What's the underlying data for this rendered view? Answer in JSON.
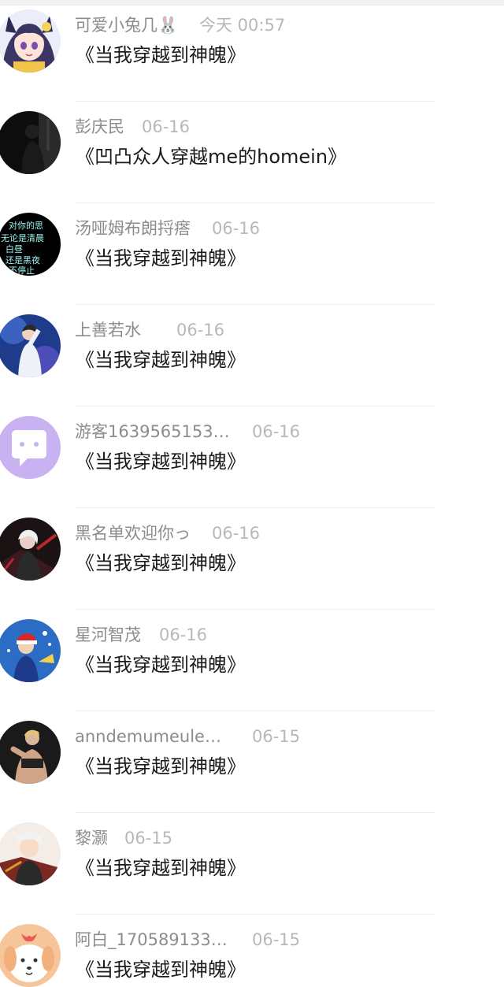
{
  "comments": [
    {
      "user": "可爱小兔几🐰",
      "date": "今天 00:57",
      "text": "《当我穿越到神魄》",
      "avatar": "anime-girl-avatar"
    },
    {
      "user": "彭庆民",
      "date": "06-16",
      "text": "《凹凸众人穿越me的homein》",
      "avatar": "dark-silhouette-avatar"
    },
    {
      "user": "汤哑姆布朗捋瘩",
      "date": "06-16",
      "text": "《当我穿越到神魄》",
      "avatar": "text-quote-avatar",
      "avatar_text": [
        "对你的思",
        "无论是清晨",
        "白昼",
        "还是黑夜",
        "不停止"
      ]
    },
    {
      "user": "上善若水",
      "date": "06-16",
      "text": "《当我穿越到神魄》",
      "avatar": "stage-performer-avatar"
    },
    {
      "user": "游客1639565153…",
      "date": "06-16",
      "text": "《当我穿越到神魄》",
      "avatar": "chat-bubble-avatar"
    },
    {
      "user": "黑名单欢迎你っ",
      "date": "06-16",
      "text": "《当我穿越到神魄》",
      "avatar": "dark-anime-avatar"
    },
    {
      "user": "星河智茂",
      "date": "06-16",
      "text": "《当我穿越到神魄》",
      "avatar": "anime-trainer-avatar"
    },
    {
      "user": "anndemumeule…",
      "date": "06-15",
      "text": "《当我穿越到神魄》",
      "avatar": "fitness-avatar"
    },
    {
      "user": "黎灏",
      "date": "06-15",
      "text": "《当我穿越到神魄》",
      "avatar": "anime-boy-avatar"
    },
    {
      "user": "阿白_170589133…",
      "date": "06-15",
      "text": "《当我穿越到神魄》",
      "avatar": "puppy-avatar"
    }
  ],
  "colors": {
    "username": "#8c8c8c",
    "date": "#b8b8b8",
    "text": "#1a1a1a",
    "chat_bubble_bg": "#c8b2f2"
  }
}
